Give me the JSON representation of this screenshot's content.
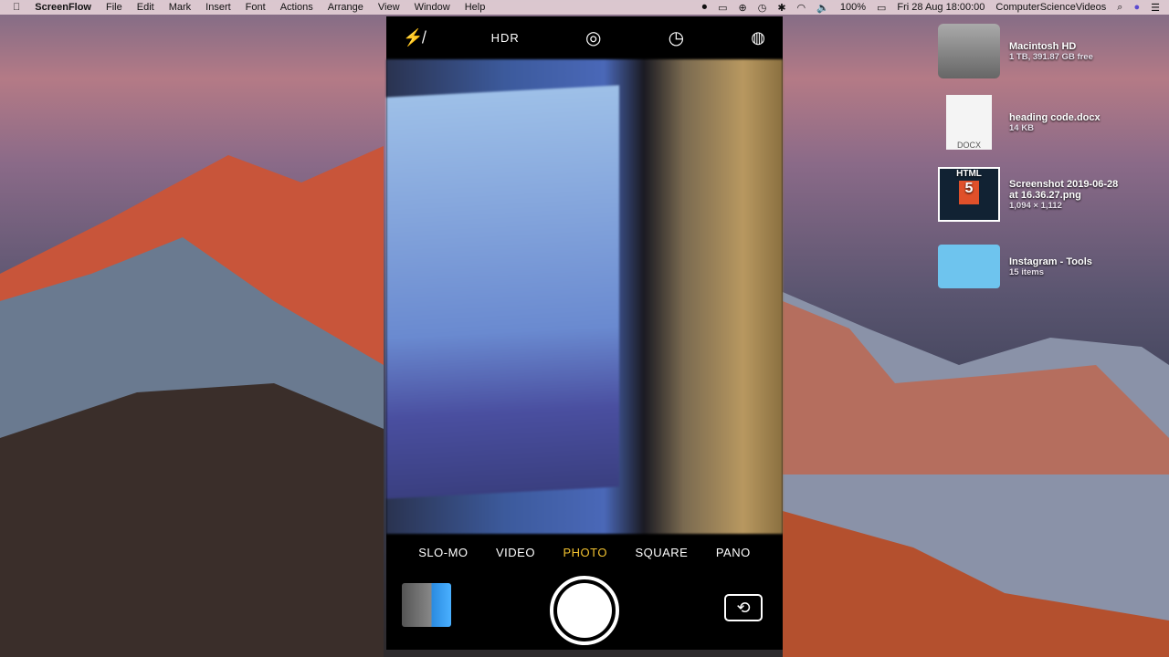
{
  "menubar": {
    "app": "ScreenFlow",
    "items": [
      "File",
      "Edit",
      "Mark",
      "Insert",
      "Font",
      "Actions",
      "Arrange",
      "View",
      "Window",
      "Help"
    ],
    "battery": "100%",
    "datetime": "Fri 28 Aug  18:00:00",
    "user": "ComputerScienceVideos"
  },
  "camera": {
    "hdr": "HDR",
    "modes": [
      "SLO-MO",
      "VIDEO",
      "PHOTO",
      "SQUARE",
      "PANO"
    ],
    "active_mode": "PHOTO"
  },
  "desktop": [
    {
      "name": "Macintosh HD",
      "sub": "1 TB, 391.87 GB free"
    },
    {
      "name": "heading code.docx",
      "sub": "14 KB",
      "badge": "DOCX"
    },
    {
      "name": "Screenshot 2019-06-28 at 16.36.27.png",
      "sub": "1,094 × 1,112",
      "badge": "HTML"
    },
    {
      "name": "Instagram - Tools",
      "sub": "15 items"
    }
  ]
}
